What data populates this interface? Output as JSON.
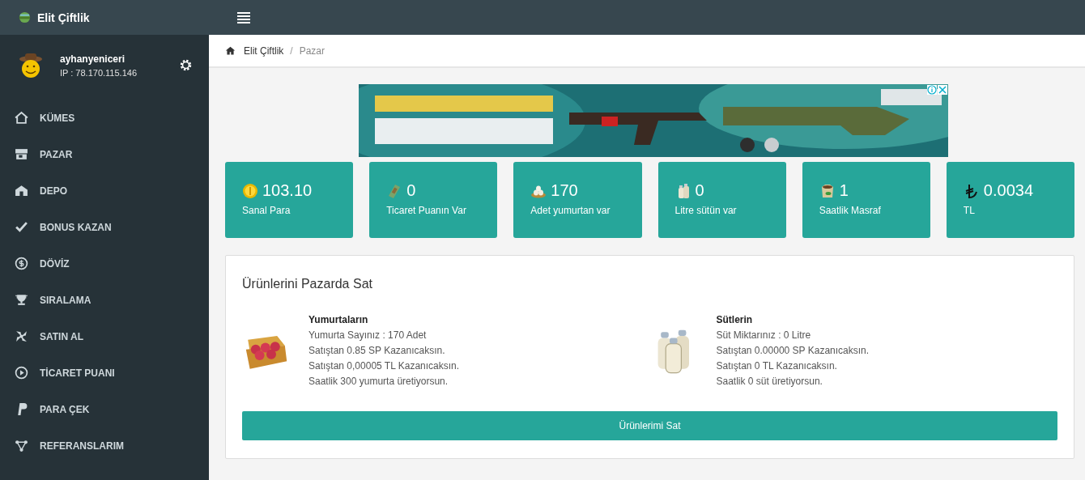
{
  "brand": {
    "name": "Elit Çiftlik"
  },
  "user": {
    "name": "ayhanyeniceri",
    "ip": "IP : 78.170.115.146"
  },
  "sidebar": {
    "items": [
      {
        "label": "KÜMES"
      },
      {
        "label": "PAZAR"
      },
      {
        "label": "DEPO"
      },
      {
        "label": "BONUS KAZAN"
      },
      {
        "label": "DÖVİZ"
      },
      {
        "label": "SIRALAMA"
      },
      {
        "label": "SATIN AL"
      },
      {
        "label": "TİCARET PUANI"
      },
      {
        "label": "PARA ÇEK"
      },
      {
        "label": "REFERANSLARIM"
      }
    ]
  },
  "breadcrumb": {
    "separator": "/",
    "items": [
      {
        "label": "Elit Çiftlik"
      },
      {
        "label": "Pazar"
      }
    ]
  },
  "stats": [
    {
      "value": "103.10",
      "label": "Sanal Para"
    },
    {
      "value": "0",
      "label": "Ticaret Puanın Var"
    },
    {
      "value": "170",
      "label": "Adet yumurtan var"
    },
    {
      "value": "0",
      "label": "Litre sütün var"
    },
    {
      "value": "1",
      "label": "Saatlik Masraf"
    },
    {
      "value": "0.0034",
      "label": "TL"
    }
  ],
  "panel": {
    "title": "Ürünlerini Pazarda Sat",
    "products": [
      {
        "title": "Yumurtaların",
        "lines": [
          "Yumurta Sayınız : 170 Adet",
          "Satıştan 0.85 SP Kazanıcaksın.",
          "Satıştan 0,00005 TL Kazanıcaksın.",
          "Saatlik 300 yumurta üretiyorsun."
        ]
      },
      {
        "title": "Sütlerin",
        "lines": [
          "Süt Miktarınız : 0 Litre",
          "Satıştan 0.00000 SP Kazanıcaksın.",
          "Satıştan 0 TL Kazanıcaksın.",
          "Saatlik 0 süt üretiyorsun."
        ]
      }
    ],
    "button": "Ürünlerimi Sat"
  }
}
